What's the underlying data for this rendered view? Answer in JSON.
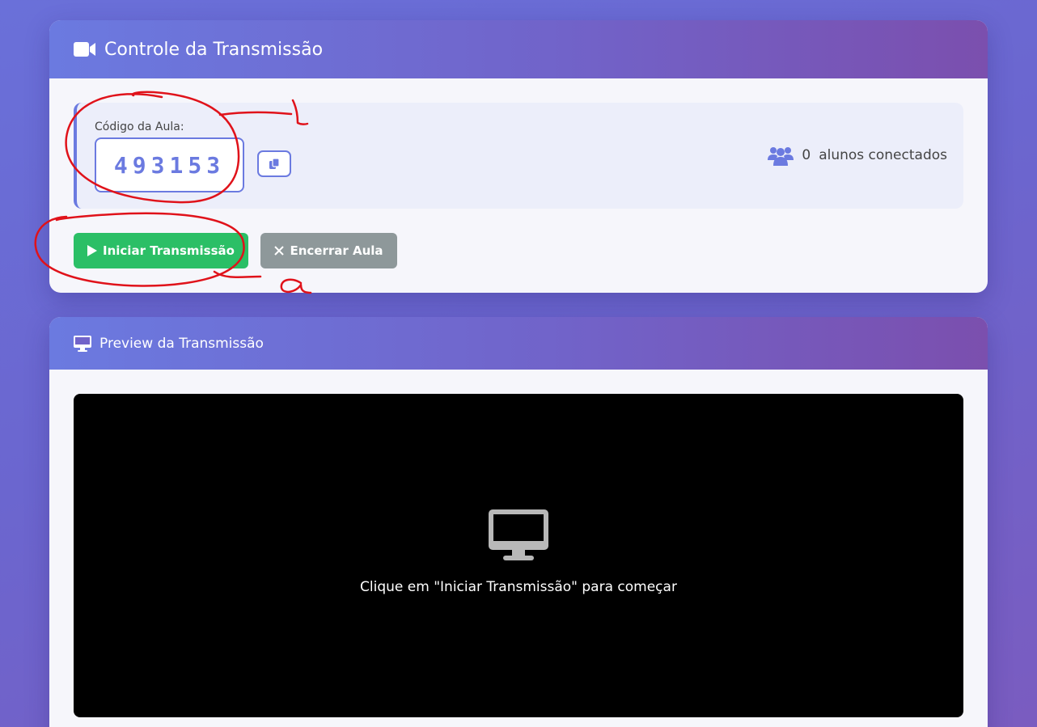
{
  "control": {
    "title": "Controle da Transmissão",
    "title_icon": "video-camera-icon",
    "code_label": "Código da Aula:",
    "code_value": "493153",
    "copy_icon": "copy-icon",
    "students_icon": "users-icon",
    "students_count": "0",
    "students_label": "alunos conectados",
    "start_button": "Iniciar Transmissão",
    "start_icon": "play-icon",
    "end_button": "Encerrar Aula",
    "end_icon": "close-icon"
  },
  "preview": {
    "title": "Preview da Transmissão",
    "title_icon": "monitor-icon",
    "placeholder_icon": "desktop-icon",
    "placeholder_text": "Clique em \"Iniciar Transmissão\" para começar"
  },
  "colors": {
    "accent": "#6b7ae0",
    "start": "#2bbf66",
    "end": "#8e989a",
    "annotation": "#e0121a"
  }
}
